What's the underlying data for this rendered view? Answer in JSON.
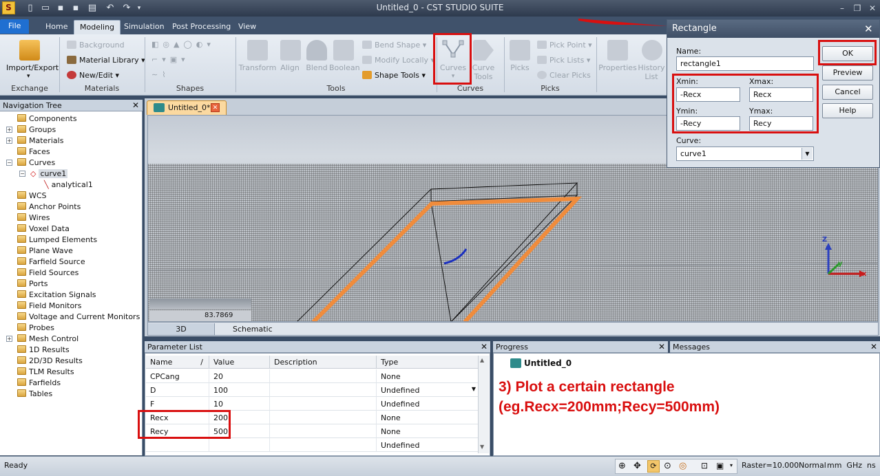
{
  "app": {
    "title": "Untitled_0 - CST STUDIO SUITE"
  },
  "ribbon": {
    "tabs": [
      "File",
      "Home",
      "Modeling",
      "Simulation",
      "Post Processing",
      "View"
    ],
    "groups": {
      "exchange": {
        "label": "Exchange",
        "import_export": "Import/Export"
      },
      "materials": {
        "label": "Materials",
        "background": "Background",
        "material_library": "Material Library",
        "new_edit": "New/Edit"
      },
      "shapes": {
        "label": "Shapes"
      },
      "tools": {
        "label": "Tools",
        "transform": "Transform",
        "align": "Align",
        "blend": "Blend",
        "boolean": "Boolean",
        "bend_shape": "Bend Shape",
        "modify_locally": "Modify Locally",
        "shape_tools": "Shape Tools"
      },
      "curves": {
        "label": "Curves",
        "curves": "Curves",
        "curve_tools_1": "Curve",
        "curve_tools_2": "Tools"
      },
      "picks": {
        "label": "Picks",
        "picks": "Picks",
        "pick_point": "Pick Point",
        "pick_lists": "Pick Lists",
        "clear_picks": "Clear Picks"
      },
      "misc": {
        "properties": "Properties",
        "history_1": "History",
        "history_2": "List"
      }
    }
  },
  "nav": {
    "title": "Navigation Tree",
    "items": [
      "Components",
      "Groups",
      "Materials",
      "Faces",
      "Curves",
      "curve1",
      "analytical1",
      "WCS",
      "Anchor Points",
      "Wires",
      "Voxel Data",
      "Lumped Elements",
      "Plane Wave",
      "Farfield Source",
      "Field Sources",
      "Ports",
      "Excitation Signals",
      "Field Monitors",
      "Voltage and Current Monitors",
      "Probes",
      "Mesh Control",
      "1D Results",
      "2D/3D Results",
      "TLM Results",
      "Farfields",
      "Tables"
    ]
  },
  "document": {
    "tab": "Untitled_0*",
    "view_tabs": [
      "3D",
      "Schematic"
    ],
    "readout": "83.7869",
    "axes": {
      "x": "x",
      "y": "y",
      "z": "Z"
    }
  },
  "params": {
    "title": "Parameter List",
    "columns": [
      "Name",
      "/",
      "Value",
      "Description",
      "Type"
    ],
    "rows": [
      {
        "name": "CPCang",
        "value": "20",
        "desc": "",
        "type": "None"
      },
      {
        "name": "D",
        "value": "100",
        "desc": "",
        "type": "Undefined"
      },
      {
        "name": "F",
        "value": "10",
        "desc": "",
        "type": "Undefined"
      },
      {
        "name": "Recx",
        "value": "200",
        "desc": "",
        "type": "None"
      },
      {
        "name": "Recy",
        "value": "500",
        "desc": "",
        "type": "None"
      },
      {
        "name": "",
        "value": "",
        "desc": "",
        "type": "Undefined"
      }
    ]
  },
  "progress": {
    "title": "Progress",
    "item": "Untitled_0"
  },
  "messages": {
    "title": "Messages"
  },
  "annotation": {
    "line1": "3) Plot a certain rectangle",
    "line2": "(eg.Recx=200mm;Recy=500mm)",
    "color": "#d90f0f"
  },
  "dialog": {
    "title": "Rectangle",
    "name_label": "Name:",
    "name_value": "rectangle1",
    "xmin_label": "Xmin:",
    "xmin_value": "-Recx",
    "xmax_label": "Xmax:",
    "xmax_value": "Recx",
    "ymin_label": "Ymin:",
    "ymin_value": "-Recy",
    "ymax_label": "Ymax:",
    "ymax_value": "Recy",
    "curve_label": "Curve:",
    "curve_value": "curve1",
    "buttons": {
      "ok": "OK",
      "preview": "Preview",
      "cancel": "Cancel",
      "help": "Help"
    }
  },
  "status": {
    "ready": "Ready",
    "raster": "Raster=10.000",
    "mode": "Normal",
    "units": "mm  GHz  ns  K"
  }
}
